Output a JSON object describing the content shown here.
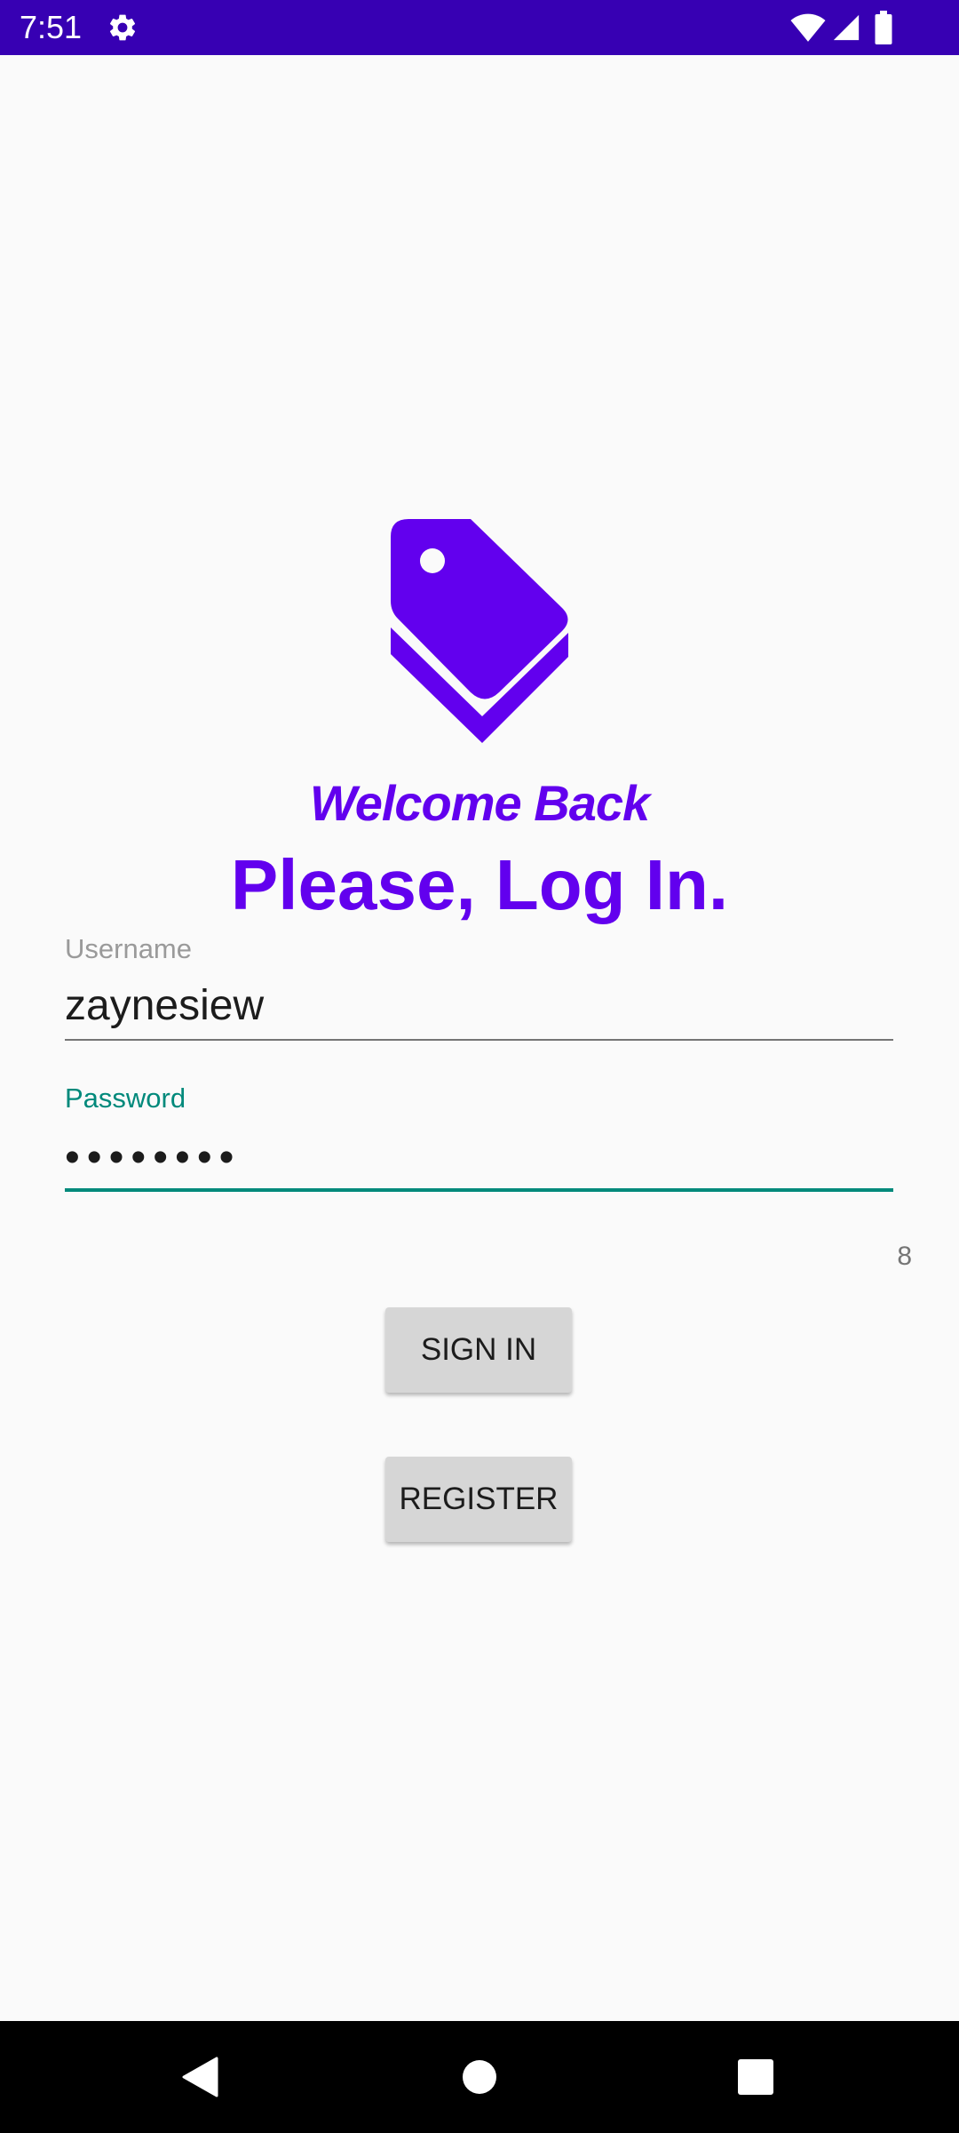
{
  "status_bar": {
    "time": "7:51",
    "icons": [
      "settings-gear-icon",
      "wifi-icon",
      "cellular-signal-icon",
      "battery-icon"
    ],
    "background_color": "#3700b3"
  },
  "login": {
    "logo_icon": "price-tags-icon",
    "welcome": "Welcome Back",
    "headline": "Please, Log In.",
    "username": {
      "label": "Username",
      "value": "zaynesiew"
    },
    "password": {
      "label": "Password",
      "value": "••••••••",
      "char_count": "8"
    },
    "sign_in_label": "SIGN IN",
    "register_label": "REGISTER"
  },
  "colors": {
    "accent": "#6200ee",
    "focus": "#00897b",
    "button": "#d6d6d6",
    "background": "#fafafa"
  },
  "nav_bar": {
    "icons": [
      "back-icon",
      "home-icon",
      "recents-icon"
    ]
  }
}
